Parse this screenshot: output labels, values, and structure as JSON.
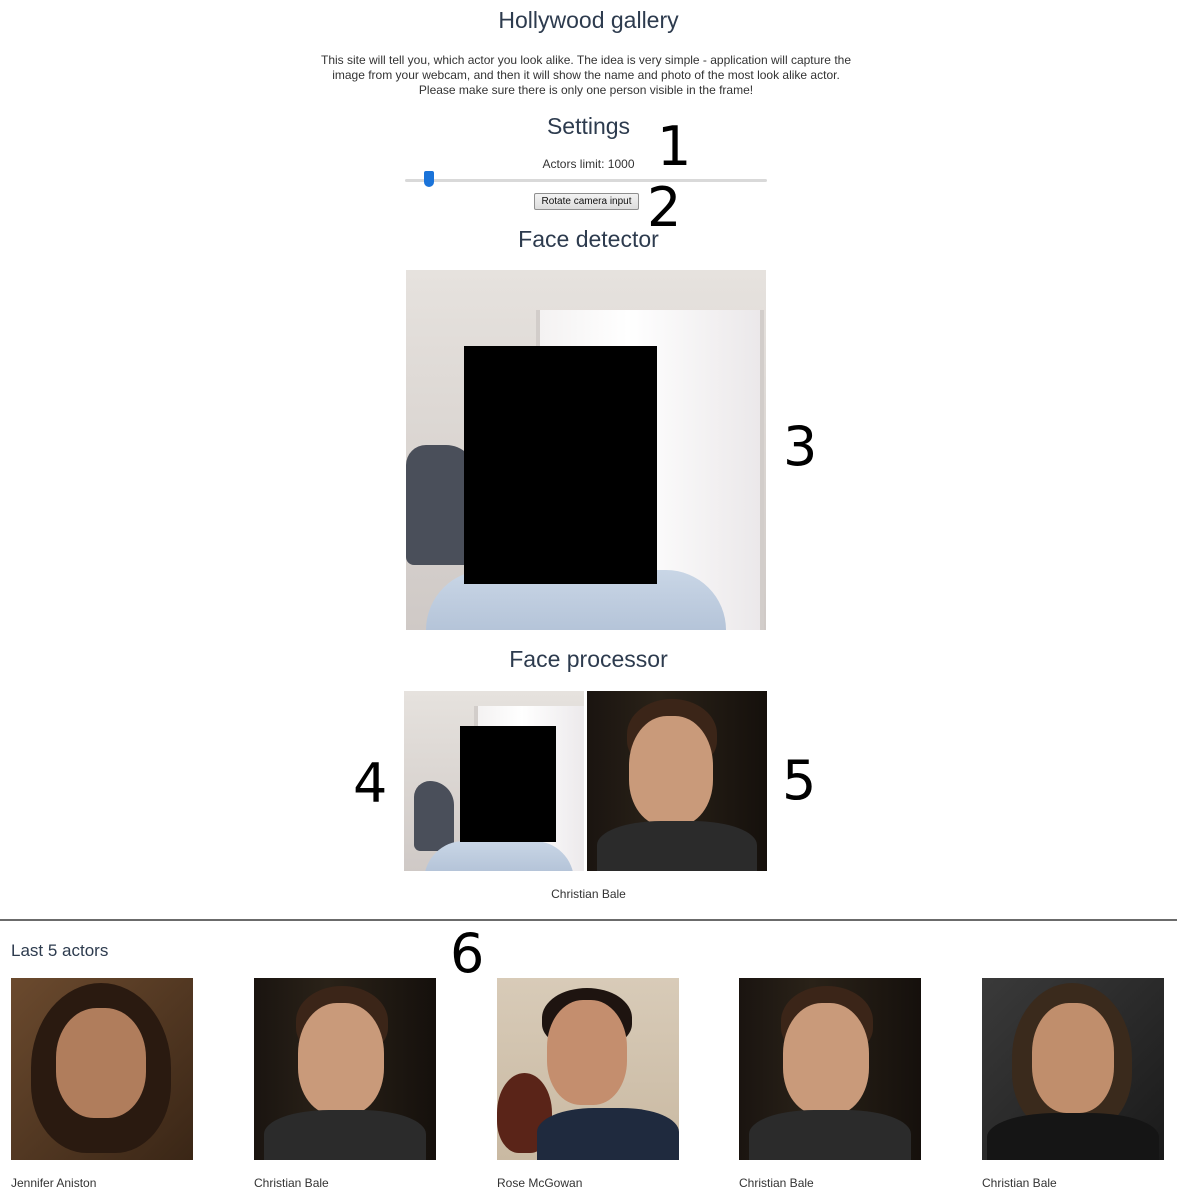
{
  "header": {
    "title": "Hollywood gallery",
    "intro_line1": "This site will tell you, which actor you look alike. The idea is very simple - application will capture the",
    "intro_line2": "image from your webcam, and then it will show the name and photo of the most look alike actor.",
    "intro_line3": "Please make sure there is only one person visible in the frame!"
  },
  "settings": {
    "title": "Settings",
    "slider_label": "Actors limit: 1000",
    "slider_value": 1000,
    "rotate_button": "Rotate camera input"
  },
  "detector": {
    "title": "Face detector"
  },
  "processor": {
    "title": "Face processor",
    "match_name": "Christian Bale"
  },
  "annotations": [
    "1",
    "2",
    "3",
    "4",
    "5",
    "6"
  ],
  "history": {
    "title": "Last 5 actors",
    "items": [
      {
        "name": "Jennifer Aniston"
      },
      {
        "name": "Christian Bale"
      },
      {
        "name": "Rose McGowan"
      },
      {
        "name": "Christian Bale"
      },
      {
        "name": "Christian Bale"
      }
    ]
  },
  "colors": {
    "heading": "#2d3b4e",
    "slider_thumb": "#1a73d9",
    "redaction": "#000000"
  }
}
